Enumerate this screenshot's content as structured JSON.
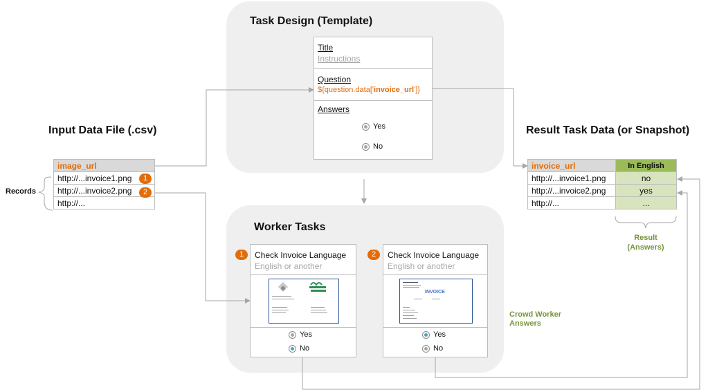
{
  "input_section": {
    "title": "Input Data File (.csv)",
    "records_label": "Records",
    "column_header": "image_url",
    "rows": [
      "http://...invoice1.png",
      "http://...invoice2.png",
      "http://..."
    ],
    "badges": [
      "1",
      "2"
    ]
  },
  "template_section": {
    "title": "Task Design (Template)",
    "title_field": "Title",
    "instructions": "Instructions",
    "question_field": "Question",
    "question_expr_prefix": "${question.data['",
    "question_expr_key": "invoice_url",
    "question_expr_suffix": "']}",
    "answers_field": "Answers",
    "options": [
      "Yes",
      "No"
    ]
  },
  "worker_section": {
    "title": "Worker Tasks",
    "tasks": [
      {
        "badge": "1",
        "title": "Check Invoice Language",
        "subtitle": "English or another",
        "options": [
          "Yes",
          "No"
        ],
        "selected": "No"
      },
      {
        "badge": "2",
        "title": "Check Invoice Language",
        "subtitle": "English or another",
        "options": [
          "Yes",
          "No"
        ],
        "selected": "Yes"
      }
    ],
    "crowd_label": "Crowd Worker Answers",
    "invoice2_heading": "INVOICE"
  },
  "result_section": {
    "title": "Result Task Data (or Snapshot)",
    "headers": [
      "invoice_url",
      "In English"
    ],
    "rows": [
      [
        "http://...invoice1.png",
        "no"
      ],
      [
        "http://...invoice2.png",
        "yes"
      ],
      [
        "http://...",
        "..."
      ]
    ],
    "result_label": "Result (Answers)"
  },
  "colors": {
    "accent_orange": "#e36c09",
    "accent_green": "#77933c",
    "header_green": "#9bbb59",
    "cell_green": "#d7e4bd",
    "panel_gray": "#efefef"
  }
}
